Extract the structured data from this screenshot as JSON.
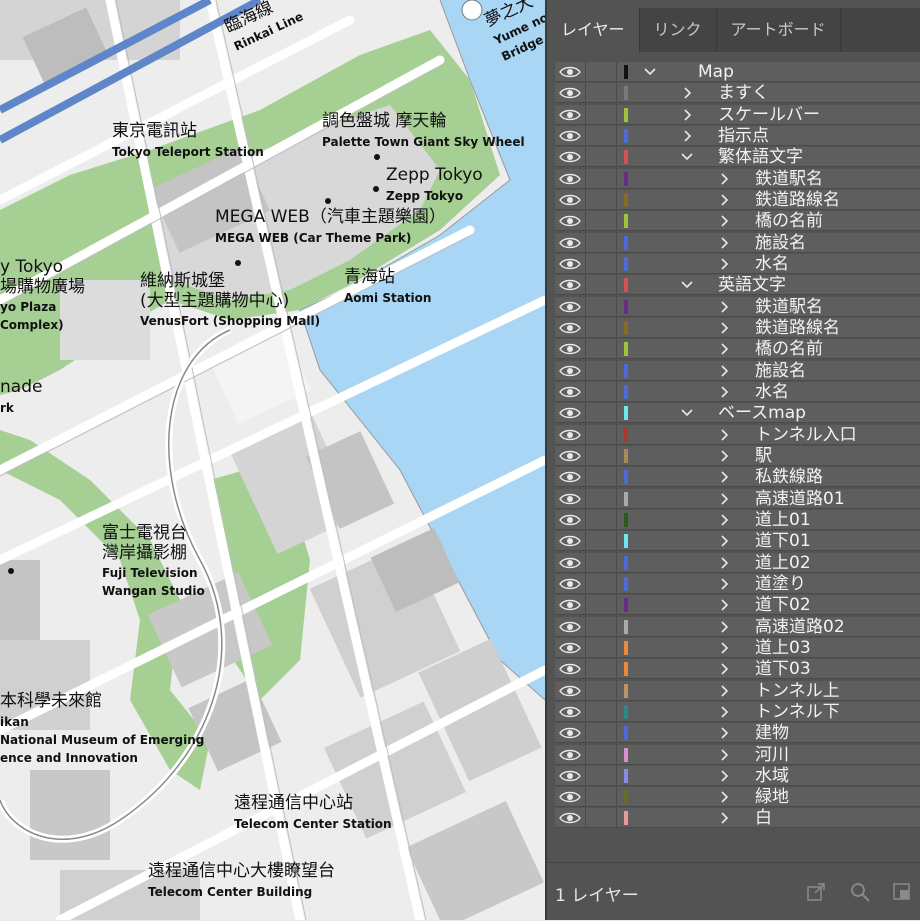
{
  "panel": {
    "tabs": [
      {
        "label": "レイヤー",
        "active": true
      },
      {
        "label": "リンク",
        "active": false
      },
      {
        "label": "アートボード",
        "active": false
      }
    ],
    "layers": [
      {
        "name": "Map",
        "level": 0,
        "expanded": true,
        "color": "#111111"
      },
      {
        "name": "ますく",
        "level": 1,
        "expanded": false,
        "color": "#7a7a7a"
      },
      {
        "name": "スケールバー",
        "level": 1,
        "expanded": false,
        "color": "#9bc43a"
      },
      {
        "name": "指示点",
        "level": 1,
        "expanded": false,
        "color": "#4b6bd8"
      },
      {
        "name": "繁体語文字",
        "level": 1,
        "expanded": true,
        "color": "#d85050"
      },
      {
        "name": "鉄道駅名",
        "level": 2,
        "expanded": false,
        "color": "#6a2a8a"
      },
      {
        "name": "鉄道路線名",
        "level": 2,
        "expanded": false,
        "color": "#8a6a2a"
      },
      {
        "name": "橋の名前",
        "level": 2,
        "expanded": false,
        "color": "#9bc43a"
      },
      {
        "name": "施設名",
        "level": 2,
        "expanded": false,
        "color": "#4b6bd8"
      },
      {
        "name": "水名",
        "level": 2,
        "expanded": false,
        "color": "#4b6bd8"
      },
      {
        "name": "英語文字",
        "level": 1,
        "expanded": true,
        "color": "#d85050"
      },
      {
        "name": "鉄道駅名",
        "level": 2,
        "expanded": false,
        "color": "#6a2a8a"
      },
      {
        "name": "鉄道路線名",
        "level": 2,
        "expanded": false,
        "color": "#8a6a2a"
      },
      {
        "name": "橋の名前",
        "level": 2,
        "expanded": false,
        "color": "#9bc43a"
      },
      {
        "name": "施設名",
        "level": 2,
        "expanded": false,
        "color": "#4b6bd8"
      },
      {
        "name": "水名",
        "level": 2,
        "expanded": false,
        "color": "#4b6bd8"
      },
      {
        "name": "ベースmap",
        "level": 1,
        "expanded": true,
        "color": "#6ee6f0"
      },
      {
        "name": "トンネル入口",
        "level": 2,
        "expanded": false,
        "color": "#a83a2a"
      },
      {
        "name": "駅",
        "level": 2,
        "expanded": false,
        "color": "#a88a5a"
      },
      {
        "name": "私鉄線路",
        "level": 2,
        "expanded": false,
        "color": "#4b6bd8"
      },
      {
        "name": "高速道路01",
        "level": 2,
        "expanded": false,
        "color": "#aaaaaa"
      },
      {
        "name": "道上01",
        "level": 2,
        "expanded": false,
        "color": "#2a5a1a"
      },
      {
        "name": "道下01",
        "level": 2,
        "expanded": false,
        "color": "#6ee6f0"
      },
      {
        "name": "道上02",
        "level": 2,
        "expanded": false,
        "color": "#4b6bd8"
      },
      {
        "name": "道塗り",
        "level": 2,
        "expanded": false,
        "color": "#4b6bd8"
      },
      {
        "name": "道下02",
        "level": 2,
        "expanded": false,
        "color": "#6a2a8a"
      },
      {
        "name": "高速道路02",
        "level": 2,
        "expanded": false,
        "color": "#aaaaaa"
      },
      {
        "name": "道上03",
        "level": 2,
        "expanded": false,
        "color": "#e88a3a"
      },
      {
        "name": "道下03",
        "level": 2,
        "expanded": false,
        "color": "#e88a3a"
      },
      {
        "name": "トンネル上",
        "level": 2,
        "expanded": false,
        "color": "#b8966a"
      },
      {
        "name": "トンネル下",
        "level": 2,
        "expanded": false,
        "color": "#2a8a8a"
      },
      {
        "name": "建物",
        "level": 2,
        "expanded": false,
        "color": "#4b6bd8"
      },
      {
        "name": "河川",
        "level": 2,
        "expanded": false,
        "color": "#d890c8"
      },
      {
        "name": "水域",
        "level": 2,
        "expanded": false,
        "color": "#8a8ae8"
      },
      {
        "name": "緑地",
        "level": 2,
        "expanded": false,
        "color": "#6a6a2a"
      },
      {
        "name": "白",
        "level": 2,
        "expanded": false,
        "color": "#e89a9a"
      }
    ],
    "footer": {
      "count": "1 レイヤー"
    }
  },
  "map": {
    "labels": {
      "rinkai_zh": "臨海線",
      "rinkai_en": "Rinkai Line",
      "yume_zh": "夢之大",
      "yume_en1": "Yume no",
      "yume_en2": "Bridge",
      "teleport_zh": "東京電訊站",
      "teleport_en": "Tokyo Teleport Station",
      "palette_zh": "調色盤城 摩天輪",
      "palette_en": "Palette Town Giant Sky Wheel",
      "zepp_zh": "Zepp Tokyo",
      "zepp_en": "Zepp Tokyo",
      "megaweb_zh": "MEGA WEB（汽車主題樂園）",
      "megaweb_en": "MEGA WEB (Car Theme Park)",
      "venus_zh1": "維納斯城堡",
      "venus_zh2": "(大型主題購物中心)",
      "venus_en": "VenusFort (Shopping Mall)",
      "aomi_zh": "青海站",
      "aomi_en": "Aomi Station",
      "plaza_zh1": "y Tokyo",
      "plaza_zh2": "場購物廣場",
      "plaza_en1": "yo Plaza",
      "plaza_en2": "Complex)",
      "promenade_zh": "nade",
      "promenade_en": "rk",
      "fuji_zh1": "富士電視台",
      "fuji_zh2": "灣岸攝影棚",
      "fuji_en1": "Fuji Television",
      "fuji_en2": "Wangan Studio",
      "museum_zh": "本科學未來館",
      "museum_en1": "ikan",
      "museum_en2": "National Museum of Emerging",
      "museum_en3": "ence and Innovation",
      "telecom_zh": "遠程通信中心站",
      "telecom_en": "Telecom Center Station",
      "telecombld_zh": "遠程通信中心大樓瞭望台",
      "telecombld_en": "Telecom Center Building"
    }
  }
}
